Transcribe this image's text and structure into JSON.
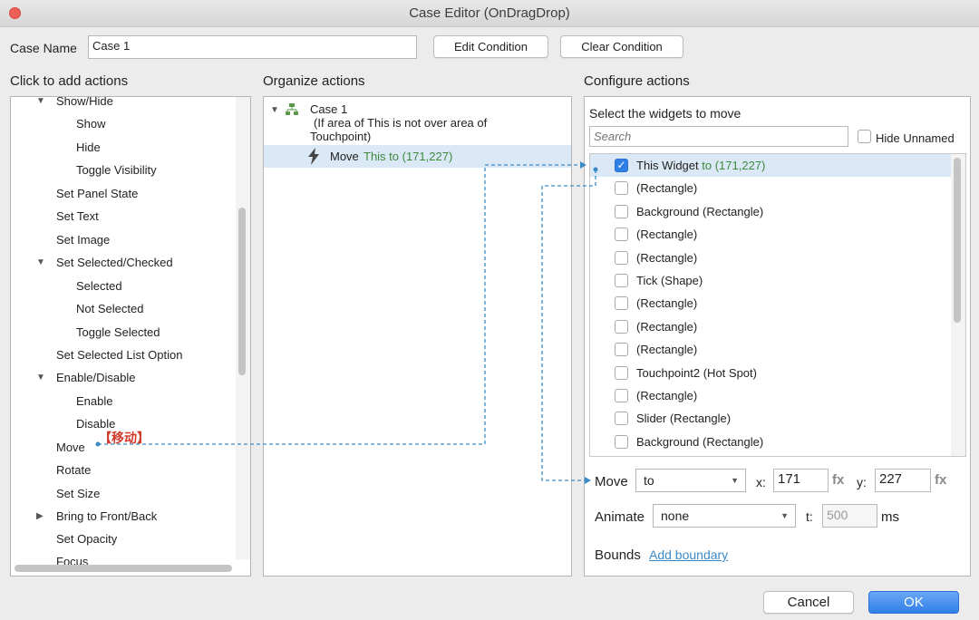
{
  "window": {
    "title": "Case Editor (OnDragDrop)"
  },
  "case_name": {
    "label": "Case Name",
    "value": "Case 1"
  },
  "buttons": {
    "edit_condition": "Edit Condition",
    "clear_condition": "Clear Condition",
    "cancel": "Cancel",
    "ok": "OK"
  },
  "sections": {
    "add_actions": "Click to add actions",
    "organize": "Organize actions",
    "configure": "Configure actions"
  },
  "actions": [
    {
      "label": "Show/Hide",
      "expander": "▼"
    },
    {
      "label": "Show"
    },
    {
      "label": "Hide"
    },
    {
      "label": "Toggle Visibility"
    },
    {
      "label": "Set Panel State"
    },
    {
      "label": "Set Text"
    },
    {
      "label": "Set Image"
    },
    {
      "label": "Set Selected/Checked",
      "expander": "▼"
    },
    {
      "label": "Selected"
    },
    {
      "label": "Not Selected"
    },
    {
      "label": "Toggle Selected"
    },
    {
      "label": "Set Selected List Option"
    },
    {
      "label": "Enable/Disable",
      "expander": "▼"
    },
    {
      "label": "Enable"
    },
    {
      "label": "Disable"
    },
    {
      "label": "Move"
    },
    {
      "label": "Rotate"
    },
    {
      "label": "Set Size"
    },
    {
      "label": "Bring to Front/Back",
      "expander": "▶"
    },
    {
      "label": "Set Opacity"
    },
    {
      "label": "Focus"
    }
  ],
  "annotation": "【移动】",
  "organize": {
    "case_title": "Case 1",
    "case_condition_line1": "(If area of This is not over area of",
    "case_condition_line2": "Touchpoint)",
    "action_verb": "Move",
    "action_detail": "This to (171,227)"
  },
  "configure": {
    "select_label": "Select the widgets to move",
    "search_placeholder": "Search",
    "hide_unnamed": "Hide Unnamed",
    "widgets": [
      {
        "label": "This Widget",
        "suffix": "to (171,227)",
        "checked": true
      },
      {
        "label": "(Rectangle)",
        "checked": false
      },
      {
        "label": "Background (Rectangle)",
        "checked": false
      },
      {
        "label": "(Rectangle)",
        "checked": false
      },
      {
        "label": "(Rectangle)",
        "checked": false
      },
      {
        "label": "Tick (Shape)",
        "checked": false
      },
      {
        "label": "(Rectangle)",
        "checked": false
      },
      {
        "label": "(Rectangle)",
        "checked": false
      },
      {
        "label": "(Rectangle)",
        "checked": false
      },
      {
        "label": "Touchpoint2 (Hot Spot)",
        "checked": false
      },
      {
        "label": "(Rectangle)",
        "checked": false
      },
      {
        "label": "Slider (Rectangle)",
        "checked": false
      },
      {
        "label": "Background (Rectangle)",
        "checked": false
      }
    ],
    "move_label": "Move",
    "move_mode": "to",
    "x_label": "x:",
    "x_value": "171",
    "y_label": "y:",
    "y_value": "227",
    "fx": "fx",
    "animate_label": "Animate",
    "animate_value": "none",
    "t_label": "t:",
    "t_value": "500",
    "ms_label": "ms",
    "bounds_label": "Bounds",
    "add_boundary": "Add boundary"
  },
  "colors": {
    "accent": "#2f7fe8",
    "selection": "#dbe8f5",
    "green_text": "#3d8a3d",
    "annotation": "#d03a2a",
    "connector": "#3a8cc8"
  },
  "icons": {
    "close": "close-dot",
    "case": "case-tree-icon",
    "action": "lightning-icon",
    "check": "checkmark-icon"
  }
}
